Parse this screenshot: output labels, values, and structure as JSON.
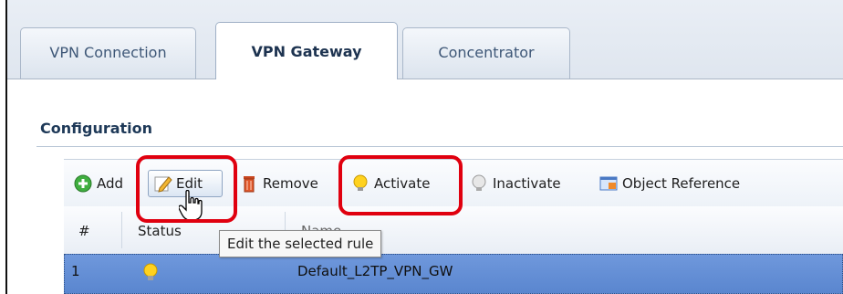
{
  "tabs": [
    {
      "label": "VPN Connection",
      "active": false
    },
    {
      "label": "VPN Gateway",
      "active": true
    },
    {
      "label": "Concentrator",
      "active": false
    }
  ],
  "section": {
    "title": "Configuration"
  },
  "toolbar": {
    "add_label": "Add",
    "edit_label": "Edit",
    "remove_label": "Remove",
    "activate_label": "Activate",
    "inactivate_label": "Inactivate",
    "object_reference_label": "Object Reference"
  },
  "table": {
    "columns": [
      "#",
      "Status",
      "Name"
    ],
    "rows": [
      {
        "index": "1",
        "status_icon": "lightbulb-on-icon",
        "name": "Default_L2TP_VPN_GW",
        "selected": true
      }
    ]
  },
  "tooltip": {
    "text": "Edit the selected rule"
  },
  "colors": {
    "highlight_red": "#e0000f",
    "selected_row": "#5f8ad2",
    "tab_text": "#3e5777"
  }
}
